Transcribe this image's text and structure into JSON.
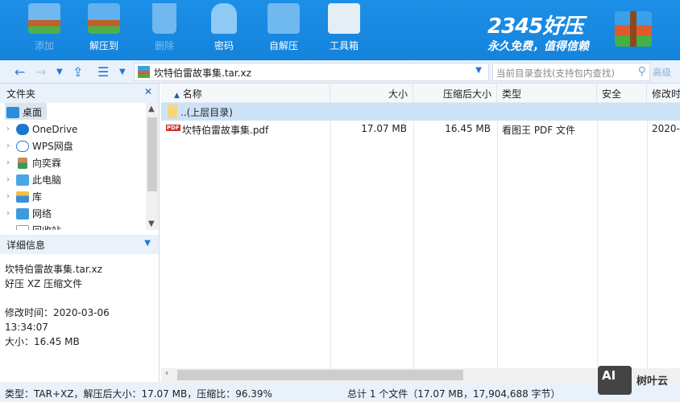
{
  "toolbar": {
    "buttons": [
      {
        "label": "添加",
        "enabled": false
      },
      {
        "label": "解压到",
        "enabled": true
      },
      {
        "label": "删除",
        "enabled": false
      },
      {
        "label": "密码",
        "enabled": true
      },
      {
        "label": "自解压",
        "enabled": true
      },
      {
        "label": "工具箱",
        "enabled": true
      }
    ],
    "logo": {
      "brand": "2345好压",
      "slogan": "永久免费，值得信赖"
    }
  },
  "nav": {
    "path": "坎特伯雷故事集.tar.xz",
    "search_placeholder": "当前目录查找(支持包内查找)",
    "advanced": "高级"
  },
  "folders": {
    "title": "文件夹",
    "items": [
      "桌面",
      "OneDrive",
      "WPS网盘",
      "向奕霖",
      "此电脑",
      "库",
      "网络",
      "回收站"
    ]
  },
  "details": {
    "title": "详细信息",
    "name": "坎特伯雷故事集.tar.xz",
    "type": "好压 XZ 压缩文件",
    "modified": "修改时间：2020-03-06 13:34:07",
    "size": "大小：16.45 MB"
  },
  "columns": [
    "名称",
    "大小",
    "压缩后大小",
    "类型",
    "安全",
    "修改时"
  ],
  "rows": [
    {
      "name": "..(上层目录)",
      "size": "",
      "packed": "",
      "type": "",
      "modified": ""
    },
    {
      "name": "坎特伯雷故事集.pdf",
      "size": "17.07 MB",
      "packed": "16.45 MB",
      "type": "看图王 PDF 文件",
      "modified": "2020-"
    }
  ],
  "status": {
    "left": "类型：TAR+XZ，解压后大小：17.07 MB，压缩比：96.39%",
    "right": "总计 1 个文件（17.07 MB，17,904,688 字节）"
  },
  "watermark": {
    "text": "树叶云",
    "badge": "AI"
  }
}
